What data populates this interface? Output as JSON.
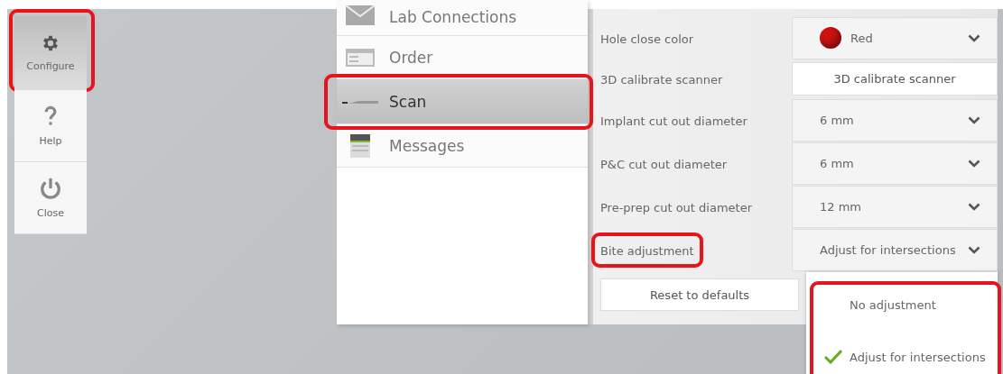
{
  "sidebar": {
    "items": [
      {
        "label": "Configure",
        "selected": true,
        "highlighted": true
      },
      {
        "label": "Help",
        "selected": false,
        "highlighted": false
      },
      {
        "label": "Close",
        "selected": false,
        "highlighted": false
      }
    ]
  },
  "menu": {
    "items": [
      {
        "label": "Lab Connections",
        "selected": false,
        "highlighted": false
      },
      {
        "label": "Order",
        "selected": false,
        "highlighted": false
      },
      {
        "label": "Scan",
        "selected": true,
        "highlighted": true
      },
      {
        "label": "Messages",
        "selected": false,
        "highlighted": false
      }
    ]
  },
  "settings": {
    "rows": [
      {
        "label": "Hole close color",
        "kind": "dropdown",
        "value": "Red",
        "color": "#cc1111",
        "highlighted": false
      },
      {
        "label": "3D calibrate scanner",
        "kind": "button",
        "value": "3D calibrate scanner",
        "highlighted": false
      },
      {
        "label": "Implant cut out diameter",
        "kind": "dropdown",
        "value": "6 mm",
        "highlighted": false
      },
      {
        "label": "P&C cut out diameter",
        "kind": "dropdown",
        "value": "6 mm",
        "highlighted": false
      },
      {
        "label": "Pre-prep cut out diameter",
        "kind": "dropdown",
        "value": "12 mm",
        "highlighted": false
      },
      {
        "label": "Bite adjustment",
        "kind": "dropdown",
        "value": "Adjust for intersections",
        "highlighted": true
      }
    ],
    "reset_button": "Reset to defaults"
  },
  "dropdown_menu": {
    "highlighted": true,
    "options": [
      {
        "label": "No adjustment",
        "selected": false
      },
      {
        "label": "Adjust for intersections",
        "selected": true
      }
    ]
  }
}
